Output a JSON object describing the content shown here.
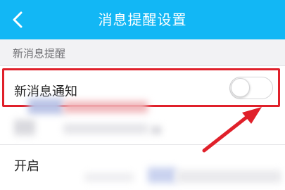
{
  "header": {
    "title": "消息提醒设置",
    "back_icon": "chevron-left-icon",
    "background": "#12b7f5"
  },
  "section": {
    "label": "新消息提醒"
  },
  "new_message_setting": {
    "label": "新消息通知",
    "toggle_state": "off",
    "highlight_color": "#e0202a"
  },
  "enable_setting": {
    "label": "开启"
  },
  "annotation": {
    "arrow_icon": "red-arrow-icon",
    "arrow_color": "#e0202a"
  }
}
